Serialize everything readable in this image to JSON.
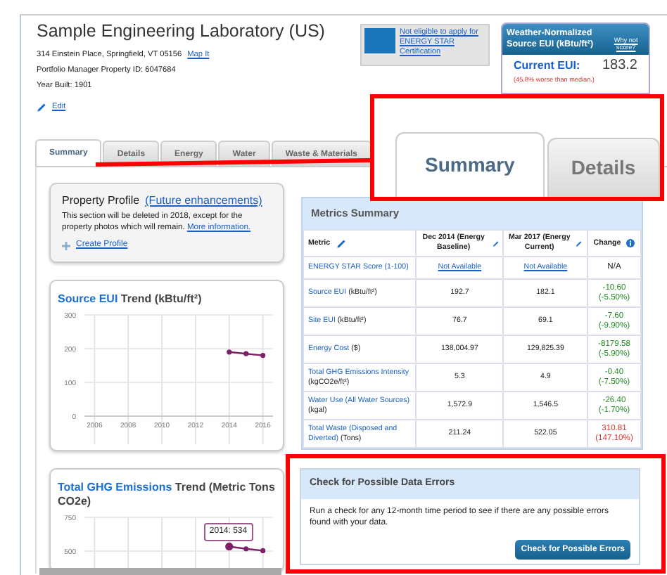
{
  "property": {
    "name": "Sample Engineering Laboratory (US)",
    "address": "314 Einstein Place, Springfield, VT 05156",
    "map_link": "Map It",
    "pm_id": "Portfolio Manager Property ID: 6047684",
    "year_built": "Year Built: 1901",
    "edit": "Edit"
  },
  "energy_star": {
    "text": "Not eligible to apply for ENERGY STAR Certification"
  },
  "eui_box": {
    "title": "Weather-Normalized Source EUI (kBtu/ft²)",
    "why_link": "Why not score?",
    "current_label": "Current EUI:",
    "current_value": "183.2",
    "comparison": "(45.8% worse than median.)"
  },
  "tabs": [
    {
      "label": "Summary",
      "selected": true
    },
    {
      "label": "Details",
      "selected": false
    },
    {
      "label": "Energy",
      "selected": false
    },
    {
      "label": "Water",
      "selected": false
    },
    {
      "label": "Waste & Materials",
      "selected": false
    }
  ],
  "profile": {
    "title": "Property Profile",
    "title_link": "(Future enhancements)",
    "text": "This section will be deleted in 2018, except for the property photos which will remain.",
    "more_link": "More information.",
    "create_link": "Create Profile"
  },
  "charts": [
    {
      "title_link": "Source EUI",
      "title": "Trend (kBtu/ft²)",
      "chart_data": {
        "type": "line",
        "x": [
          2014,
          2015,
          2016
        ],
        "series": [
          {
            "color": "#7b2167",
            "marker": "circle",
            "values": [
              190,
              185,
              180
            ]
          }
        ],
        "xlim": [
          2005.4,
          2016.6
        ],
        "ylim": [
          0,
          300
        ],
        "grid": true,
        "xticks": [
          2006,
          2008,
          2010,
          2012,
          2014,
          2016
        ],
        "yticks": [
          0,
          100,
          200,
          300
        ]
      }
    },
    {
      "title_link": "Total GHG Emissions",
      "title": "Trend (Metric Tons CO2e)",
      "tooltip": "2014: 534",
      "chart_data": {
        "type": "line",
        "x": [
          2014,
          2015,
          2016
        ],
        "series": [
          {
            "color": "#7b2167",
            "marker": "circle",
            "values": [
              534,
              517,
              503
            ]
          }
        ],
        "xlim": [
          2005.4,
          2016.6
        ],
        "ylim": [
          500,
          750
        ],
        "grid": true,
        "yticks": [
          500,
          750
        ]
      }
    }
  ],
  "metrics": {
    "title": "Metrics Summary",
    "columns": [
      "Metric",
      "Dec 2014 (Energy Baseline)",
      "Mar 2017 (Energy Current)",
      "Change"
    ],
    "rows": [
      {
        "metric": "ENERGY STAR Score (1-100)",
        "unit": "",
        "kind": "link",
        "baseline": "Not Available",
        "current": "Not Available",
        "change": "N/A",
        "change_pct": ""
      },
      {
        "metric": "Source EUI",
        "unit": "(kBtu/ft²)",
        "kind": "number",
        "baseline": "192.7",
        "current": "182.1",
        "change": "-10.60",
        "change_pct": "(-5.50%)",
        "color": "#228b22"
      },
      {
        "metric": "Site EUI",
        "unit": "(kBtu/ft²)",
        "kind": "number",
        "baseline": "76.7",
        "current": "69.1",
        "change": "-7.60",
        "change_pct": "(-9.90%)",
        "color": "#228b22"
      },
      {
        "metric": "Energy Cost",
        "unit": "($)",
        "kind": "number",
        "baseline": "138,004.97",
        "current": "129,825.39",
        "change": "-8179.58",
        "change_pct": "(-5.90%)",
        "color": "#228b22"
      },
      {
        "metric": "Total GHG Emissions Intensity",
        "unit": "(kgCO2e/ft²)",
        "kind": "number",
        "baseline": "5.3",
        "current": "4.9",
        "change": "-0.40",
        "change_pct": "(-7.50%)",
        "color": "#228b22"
      },
      {
        "metric": "Water Use (All Water Sources)",
        "unit": "(kgal)",
        "kind": "number",
        "baseline": "1,572.9",
        "current": "1,546.5",
        "change": "-26.40",
        "change_pct": "(-1.70%)",
        "color": "#228b22"
      },
      {
        "metric": "Total Waste (Disposed and Diverted)",
        "unit": "(Tons)",
        "kind": "number",
        "baseline": "211.24",
        "current": "522.05",
        "change": "310.81",
        "change_pct": "(147.10%)",
        "color": "#e0302a"
      }
    ]
  },
  "errors": {
    "title": "Check for Possible Data Errors",
    "text": "Run a check for any 12-month time period to see if there are any possible errors found with your data.",
    "button": "Check for Possible Errors"
  },
  "callout": {
    "tabs": [
      {
        "label": "Summary",
        "selected": true
      },
      {
        "label": "Details",
        "selected": false
      }
    ]
  }
}
